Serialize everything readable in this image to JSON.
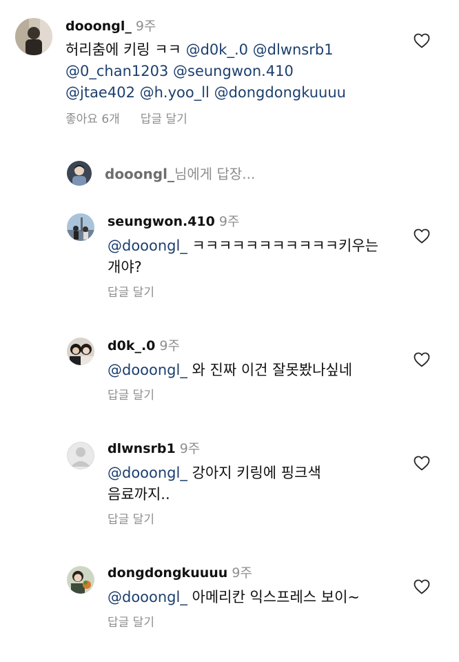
{
  "main_comment": {
    "username": "dooongl_",
    "time": "9주",
    "text_plain": "허리춤에 키링 ㅋㅋ ",
    "mentions_line1": "@d0k_.0 @dlwnsrb1",
    "mentions_line2": "@0_chan1203 @seungwon.410",
    "mentions_line3": "@jtae402 @h.yoo_ll @dongdongkuuuu",
    "likes": "좋아요 6개",
    "reply_label": "답글 달기"
  },
  "reply_input": {
    "target_user": "dooongl_",
    "suffix": "님에게 답장..."
  },
  "replies": [
    {
      "username": "seungwon.410",
      "time": "9주",
      "mention": "@dooongl_",
      "text": " ㅋㅋㅋㅋㅋㅋㅋㅋㅋㅋㅋ키우는 개야?",
      "reply_label": "답글 달기"
    },
    {
      "username": "d0k_.0",
      "time": "9주",
      "mention": "@dooongl_",
      "text": " 와 진짜 이건 잘못봤나싶네",
      "reply_label": "답글 달기"
    },
    {
      "username": "dlwnsrb1",
      "time": "9주",
      "mention": "@dooongl_",
      "text": " 강아지 키링에 핑크색 음료까지..",
      "reply_label": "답글 달기"
    },
    {
      "username": "dongdongkuuuu",
      "time": "9주",
      "mention": "@dooongl_",
      "text": " 아메리칸 익스프레스 보이~",
      "reply_label": "답글 달기"
    }
  ],
  "icons": {
    "like": "heart-outline-icon",
    "default_avatar": "default-avatar-icon"
  },
  "colors": {
    "mention": "#1c3f6e",
    "secondary_text": "#8e8e8e",
    "primary_text": "#111111"
  }
}
